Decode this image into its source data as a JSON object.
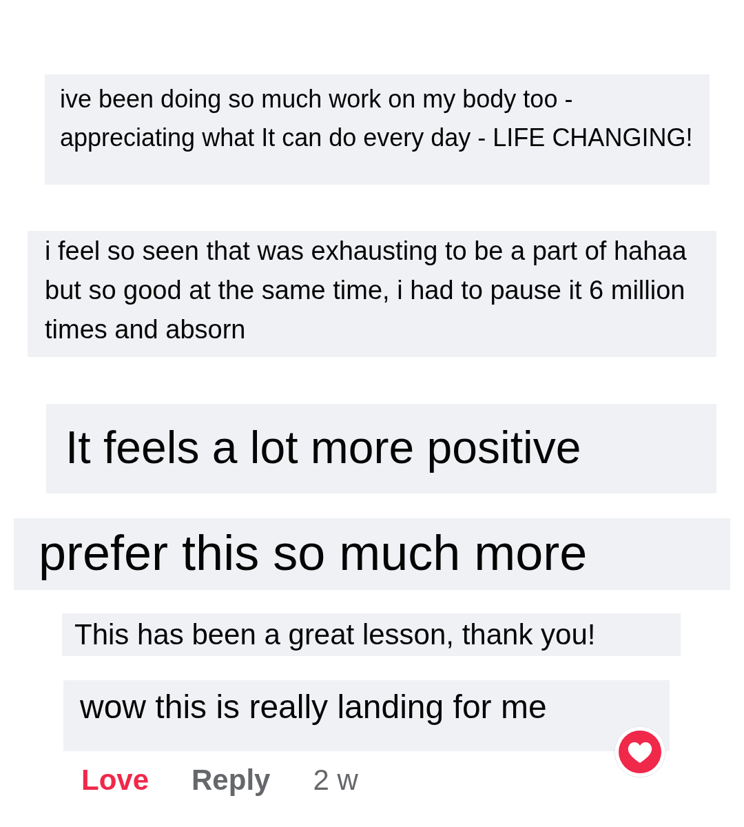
{
  "comments": [
    {
      "text": "ive been doing so much work on my body too - appreciating what It can do every day - LIFE CHANGING!"
    },
    {
      "text": "i feel so seen that was exhausting to be a part of hahaa but so good at the same time, i had to pause it 6 million times and absorn"
    },
    {
      "text": "It feels a lot more positive"
    },
    {
      "text": "prefer this so much more"
    },
    {
      "text": "This has been a great lesson, thank you!"
    },
    {
      "text": "wow this is really landing for me"
    }
  ],
  "actions": [
    {
      "label": "Love",
      "selected": true
    },
    {
      "label": "Reply",
      "selected": false
    }
  ],
  "time": "2 w"
}
